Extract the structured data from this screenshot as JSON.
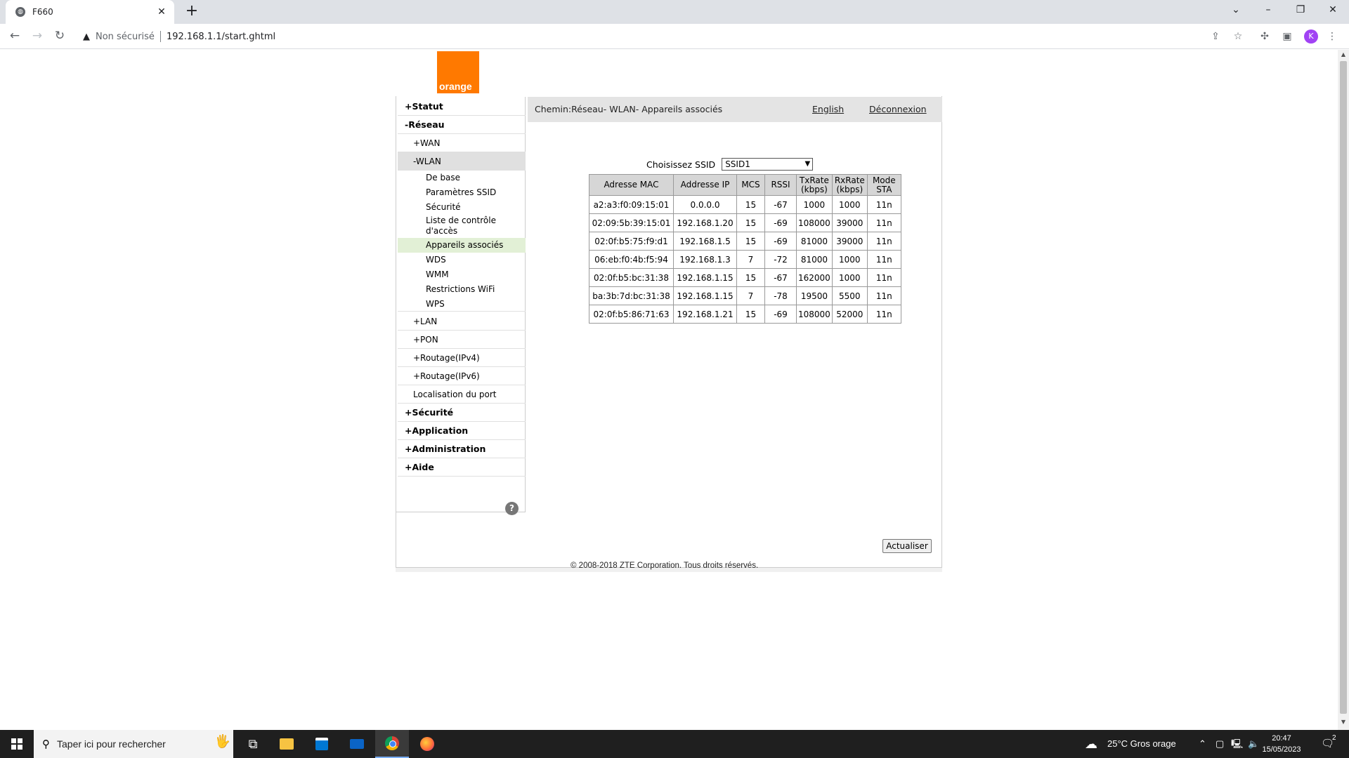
{
  "browser": {
    "tab_title": "F660",
    "insecure_label": "Non sécurisé",
    "url": "192.168.1.1/start.ghtml",
    "profile_initial": "K"
  },
  "logo": {
    "text": "orange"
  },
  "top": {
    "breadcrumb": "Chemin:Réseau- WLAN- Appareils associés",
    "english_link": "English",
    "logout_link": "Déconnexion"
  },
  "menu": {
    "statut": "+Statut",
    "reseau": "-Réseau",
    "wan": "+WAN",
    "wlan": "-WLAN",
    "de_base": "De base",
    "param_ssid": "Paramètres SSID",
    "securite_wlan": "Sécurité",
    "acl": "Liste de contrôle d'accès",
    "appareils": "Appareils associés",
    "wds": "WDS",
    "wmm": "WMM",
    "restrictions": "Restrictions WiFi",
    "wps": "WPS",
    "lan": "+LAN",
    "pon": "+PON",
    "routage4": "+Routage(IPv4)",
    "routage6": "+Routage(IPv6)",
    "localisation": "Localisation du port",
    "securite": "+Sécurité",
    "application": "+Application",
    "administration": "+Administration",
    "aide": "+Aide",
    "help_icon": "?"
  },
  "ssid": {
    "label": "Choisissez SSID",
    "selected": "SSID1"
  },
  "table": {
    "headers": {
      "mac": "Adresse MAC",
      "ip": "Addresse IP",
      "mcs": "MCS",
      "rssi": "RSSI",
      "tx1": "TxRate",
      "tx2": "(kbps)",
      "rx1": "RxRate",
      "rx2": "(kbps)",
      "mode1": "Mode",
      "mode2": "STA"
    },
    "rows": [
      {
        "mac": "a2:a3:f0:09:15:01",
        "ip": "0.0.0.0",
        "mcs": "15",
        "rssi": "-67",
        "tx": "1000",
        "rx": "1000",
        "mode": "11n"
      },
      {
        "mac": "02:09:5b:39:15:01",
        "ip": "192.168.1.20",
        "mcs": "15",
        "rssi": "-69",
        "tx": "108000",
        "rx": "39000",
        "mode": "11n"
      },
      {
        "mac": "02:0f:b5:75:f9:d1",
        "ip": "192.168.1.5",
        "mcs": "15",
        "rssi": "-69",
        "tx": "81000",
        "rx": "39000",
        "mode": "11n"
      },
      {
        "mac": "06:eb:f0:4b:f5:94",
        "ip": "192.168.1.3",
        "mcs": "7",
        "rssi": "-72",
        "tx": "81000",
        "rx": "1000",
        "mode": "11n"
      },
      {
        "mac": "02:0f:b5:bc:31:38",
        "ip": "192.168.1.15",
        "mcs": "15",
        "rssi": "-67",
        "tx": "162000",
        "rx": "1000",
        "mode": "11n"
      },
      {
        "mac": "ba:3b:7d:bc:31:38",
        "ip": "192.168.1.15",
        "mcs": "7",
        "rssi": "-78",
        "tx": "19500",
        "rx": "5500",
        "mode": "11n"
      },
      {
        "mac": "02:0f:b5:86:71:63",
        "ip": "192.168.1.21",
        "mcs": "15",
        "rssi": "-69",
        "tx": "108000",
        "rx": "52000",
        "mode": "11n"
      }
    ]
  },
  "buttons": {
    "refresh": "Actualiser"
  },
  "footer": {
    "copyright": "© 2008-2018 ZTE Corporation. Tous droits réservés."
  },
  "taskbar": {
    "search_placeholder": "Taper ici pour rechercher",
    "weather": "25°C  Gros orage",
    "time": "20:47",
    "date": "15/05/2023",
    "notif_count": "2"
  },
  "colors": {
    "orange_brand": "#ff7900",
    "active_menu_bg": "#e2f0d6",
    "breadcrumb_bg": "#e4e4e4",
    "table_header_bg": "#d6d6d6"
  }
}
